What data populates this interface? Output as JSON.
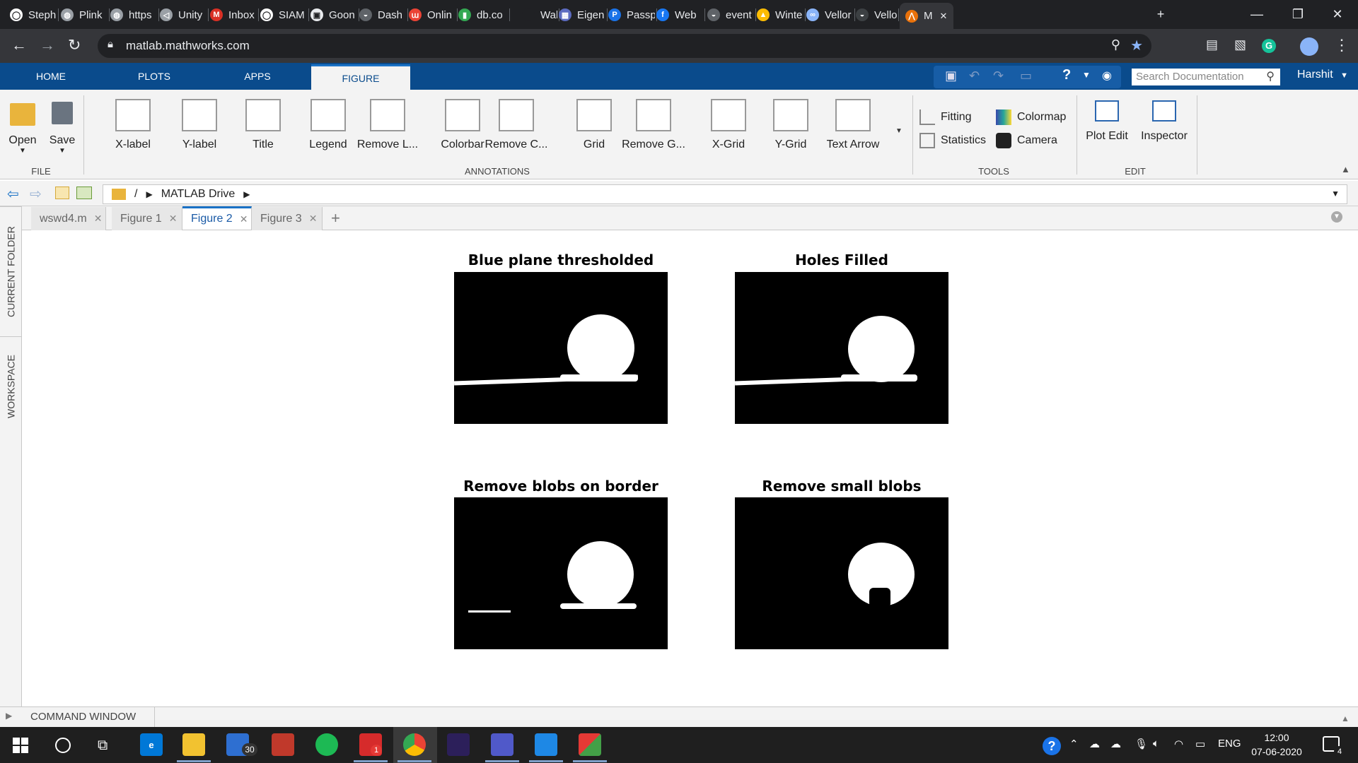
{
  "browser": {
    "tabs": [
      {
        "label": "Steph",
        "color": "#ffffff",
        "glyph": "◯"
      },
      {
        "label": "Plink",
        "color": "#9aa0a6",
        "glyph": "◍"
      },
      {
        "label": "https",
        "color": "#9aa0a6",
        "glyph": "◍"
      },
      {
        "label": "Unity",
        "color": "#9aa0a6",
        "glyph": "◁"
      },
      {
        "label": "Inbox",
        "color": "#d93025",
        "glyph": "M"
      },
      {
        "label": "SIAM",
        "color": "#ffffff",
        "glyph": "◯"
      },
      {
        "label": "Goon",
        "color": "#e8eaed",
        "glyph": "▣"
      },
      {
        "label": "Dash",
        "color": "#5f6368",
        "glyph": "◒"
      },
      {
        "label": "Onlin",
        "color": "#ea4335",
        "glyph": "ա"
      },
      {
        "label": "db.co",
        "color": "#34a853",
        "glyph": "▮"
      },
      {
        "label": "Wallp",
        "color": "#202124",
        "glyph": ""
      },
      {
        "label": "Eigen",
        "color": "#5c6bc0",
        "glyph": "▦"
      },
      {
        "label": "Passp",
        "color": "#1a73e8",
        "glyph": "P"
      },
      {
        "label": "Web",
        "color": "#1877f2",
        "glyph": "f"
      },
      {
        "label": "event",
        "color": "#5f6368",
        "glyph": "◒"
      },
      {
        "label": "Winte",
        "color": "#fbbc04",
        "glyph": "▲"
      },
      {
        "label": "Vellor",
        "color": "#8ab4f8",
        "glyph": "∞"
      },
      {
        "label": "Vellor",
        "color": "#3c4043",
        "glyph": "◒"
      },
      {
        "label": "M",
        "color": "#e8710a",
        "glyph": "⋀"
      }
    ],
    "url": "matlab.mathworks.com"
  },
  "ribbon": {
    "tabs": [
      "HOME",
      "PLOTS",
      "APPS",
      "FIGURE"
    ],
    "active_tab": "FIGURE",
    "search_placeholder": "Search Documentation",
    "user": "Harshit",
    "file_buttons": [
      "Open",
      "Save"
    ],
    "annotation_buttons": [
      "X-label",
      "Y-label",
      "Title",
      "Legend",
      "Remove L...",
      "Colorbar",
      "Remove C...",
      "Grid",
      "Remove G...",
      "X-Grid",
      "Y-Grid",
      "Text Arrow"
    ],
    "tool_buttons": [
      "Fitting",
      "Colormap",
      "Statistics",
      "Camera"
    ],
    "edit_buttons": [
      "Plot Edit",
      "Inspector"
    ],
    "groups": [
      "FILE",
      "ANNOTATIONS",
      "TOOLS",
      "EDIT"
    ]
  },
  "path": {
    "root": "/",
    "folder": "MATLAB Drive"
  },
  "side_tabs": [
    "CURRENT FOLDER",
    "WORKSPACE"
  ],
  "doc_tabs": [
    "wswd4.m",
    "Figure 1",
    "Figure 2",
    "Figure 3"
  ],
  "active_doc_tab": "Figure 2",
  "figure": {
    "subplots": [
      {
        "title": "Blue plane thresholded"
      },
      {
        "title": "Holes Filled"
      },
      {
        "title": "Remove blobs on border"
      },
      {
        "title": "Remove small blobs"
      }
    ]
  },
  "command_window": "COMMAND WINDOW",
  "taskbar": {
    "mail_badge": "30",
    "app_badge": "1",
    "language": "ENG",
    "time": "12:00",
    "date": "07-06-2020",
    "notifications": "4"
  }
}
